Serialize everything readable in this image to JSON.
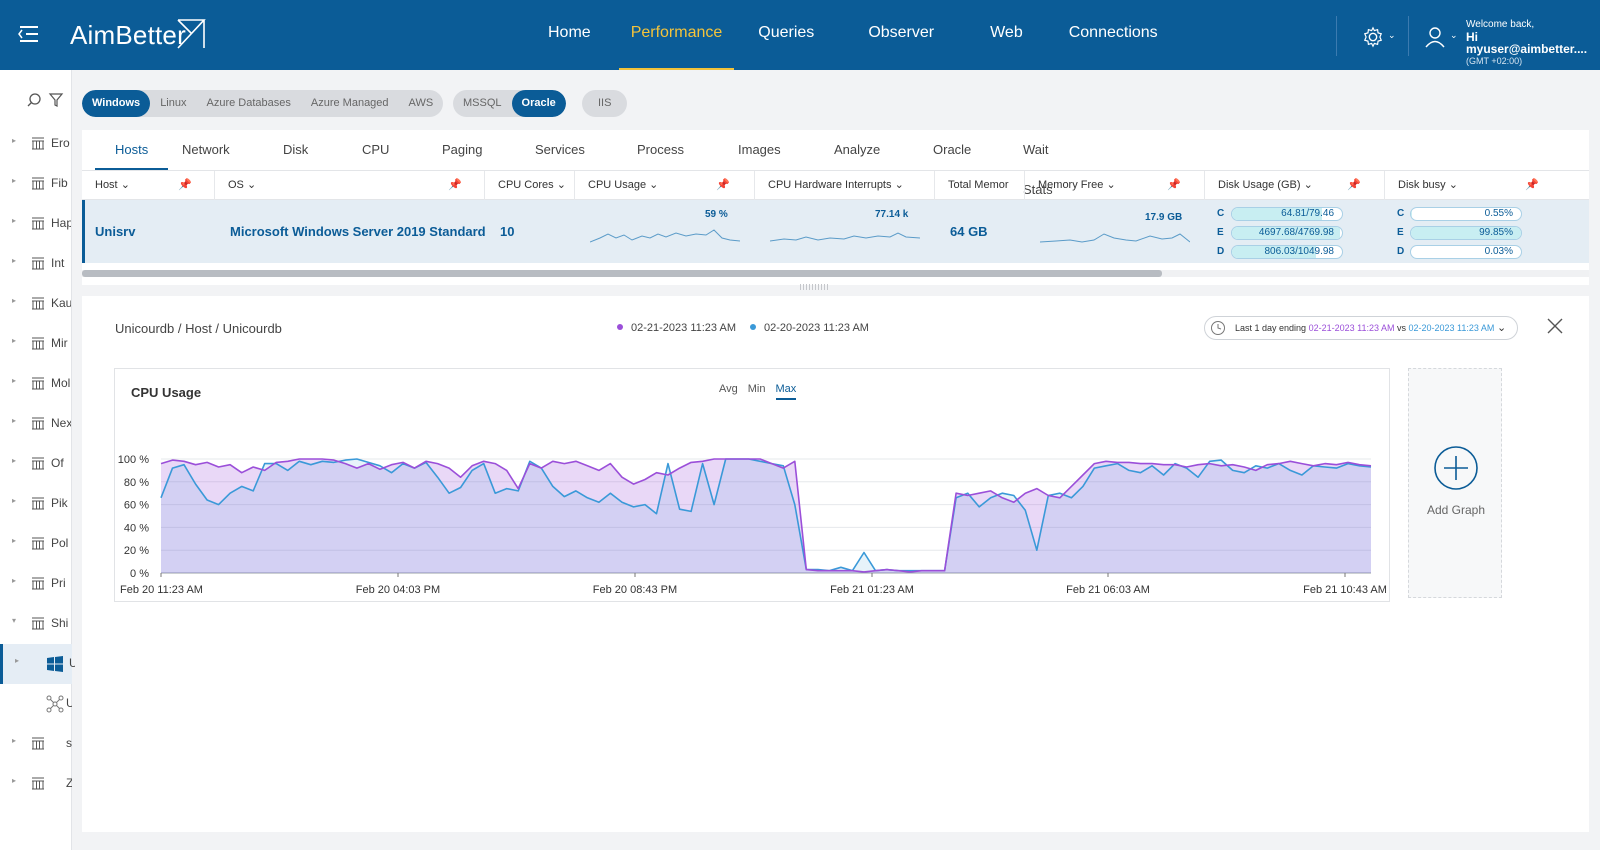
{
  "app": {
    "logo": "AimBetter",
    "nav": [
      "Home",
      "Performance",
      "Queries",
      "Observer",
      "Web",
      "Connections"
    ],
    "nav_active": "Performance",
    "user": {
      "welcome": "Welcome back,",
      "name": "Hi myuser@aimbetter....",
      "timezone": "(GMT +02:00)"
    }
  },
  "tree": {
    "items": [
      "Ero",
      "Fib",
      "Hap",
      "Int",
      "Kau",
      "Mir",
      "Mol",
      "Nex",
      "Of",
      "Pik",
      "Pol",
      "Pri",
      "Shi",
      "U",
      "U",
      "sou",
      "Zuk"
    ]
  },
  "filters": {
    "platforms": [
      "Windows",
      "Linux",
      "Azure Databases",
      "Azure Managed",
      "AWS"
    ],
    "platform_selected": "Windows",
    "db_types": [
      "MSSQL",
      "Oracle"
    ],
    "db_selected": "Oracle",
    "other": [
      "IIS"
    ]
  },
  "tabs": [
    "Hosts",
    "Network",
    "Disk",
    "CPU",
    "Paging",
    "Services",
    "Process",
    "Images",
    "Analyze",
    "Oracle",
    "Wait Stats"
  ],
  "tab_active": "Hosts",
  "grid": {
    "columns": {
      "host": "Host",
      "os": "OS",
      "cpu_cores": "CPU Cores",
      "cpu_usage": "CPU Usage",
      "cpu_hw_int": "CPU Hardware Interrupts",
      "total_mem": "Total Memor",
      "mem_free": "Memory Free",
      "disk_usage": "Disk Usage (GB)",
      "disk_busy": "Disk busy"
    },
    "row": {
      "host": "Unisrv",
      "os": "Microsoft Windows Server 2019 Standard",
      "cpu_cores": "10",
      "cpu_usage": "59 %",
      "cpu_hw_int": "77.14 k",
      "total_mem": "64 GB",
      "mem_free": "17.9 GB",
      "disk_usage": [
        {
          "drive": "C",
          "value": "64.81/79.46",
          "fraction": 0.816
        },
        {
          "drive": "E",
          "value": "4697.68/4769.98",
          "fraction": 0.985
        },
        {
          "drive": "D",
          "value": "806.03/1049.98",
          "fraction": 0.768
        }
      ],
      "disk_busy": [
        {
          "drive": "C",
          "value": "0.55%",
          "fraction": 0.0055
        },
        {
          "drive": "E",
          "value": "99.85%",
          "fraction": 0.9985
        },
        {
          "drive": "D",
          "value": "0.03%",
          "fraction": 0.0003
        }
      ]
    }
  },
  "detail": {
    "breadcrumb": "Unicourdb / Host / Unicourdb",
    "legend": [
      {
        "label": "02-21-2023 11:23 AM",
        "color": "#9b4fd9"
      },
      {
        "label": "02-20-2023 11:23 AM",
        "color": "#3a99d8"
      }
    ],
    "timepicker": {
      "prefix": "Last 1 day ending",
      "current": "02-21-2023 11:23 AM",
      "vs": "vs",
      "previous": "02-20-2023 11:23 AM"
    },
    "aggregations": [
      "Avg",
      "Min",
      "Max"
    ],
    "aggregation_selected": "Max",
    "add_graph": "Add Graph"
  },
  "chart_data": {
    "type": "line",
    "title": "CPU Usage",
    "ylim": [
      0,
      100
    ],
    "y_ticks": [
      "0 %",
      "20 %",
      "40 %",
      "60 %",
      "80 %",
      "100 %"
    ],
    "x_ticks": [
      "Feb 20 11:23 AM",
      "Feb 20 04:03 PM",
      "Feb 20 08:43 PM",
      "Feb 21 01:23 AM",
      "Feb 21 06:03 AM",
      "Feb 21 10:43 AM"
    ],
    "grid": true,
    "series": [
      {
        "name": "02-21-2023 11:23 AM",
        "color": "#9b4fd9",
        "values": [
          96,
          99,
          98,
          95,
          97,
          93,
          95,
          88,
          93,
          90,
          97,
          98,
          100,
          100,
          100,
          99,
          96,
          92,
          96,
          91,
          95,
          97,
          92,
          98,
          96,
          92,
          84,
          94,
          98,
          96,
          90,
          74,
          96,
          92,
          98,
          96,
          98,
          94,
          90,
          96,
          84,
          78,
          82,
          88,
          86,
          92,
          97,
          98,
          100,
          100,
          100,
          100,
          100,
          96,
          92,
          98,
          3,
          2,
          2,
          2,
          2,
          1,
          2,
          3,
          2,
          1,
          2,
          2,
          2,
          70,
          68,
          70,
          72,
          66,
          62,
          70,
          74,
          68,
          66,
          76,
          86,
          96,
          98,
          97,
          97,
          96,
          96,
          95,
          95,
          93,
          95,
          96,
          94,
          95,
          93,
          90,
          95,
          96,
          98,
          96,
          94,
          96,
          95,
          97,
          95,
          94
        ]
      },
      {
        "name": "02-20-2023 11:23 AM",
        "color": "#3a99d8",
        "values": [
          66,
          92,
          95,
          78,
          64,
          60,
          70,
          76,
          72,
          96,
          96,
          90,
          98,
          95,
          98,
          97,
          99,
          100,
          97,
          94,
          88,
          96,
          92,
          97,
          84,
          70,
          75,
          90,
          96,
          70,
          74,
          72,
          98,
          92,
          76,
          67,
          72,
          66,
          62,
          70,
          62,
          58,
          60,
          52,
          96,
          56,
          54,
          96,
          60,
          100,
          100,
          100,
          98,
          96,
          94,
          60,
          3,
          3,
          2,
          5,
          2,
          18,
          2,
          3,
          2,
          2,
          2,
          2,
          2,
          66,
          70,
          58,
          66,
          70,
          68,
          55,
          20,
          68,
          70,
          66,
          76,
          92,
          94,
          96,
          90,
          88,
          94,
          86,
          96,
          92,
          84,
          98,
          99,
          90,
          88,
          94,
          92,
          96,
          90,
          86,
          94,
          93,
          92,
          96,
          94,
          93
        ]
      }
    ]
  }
}
